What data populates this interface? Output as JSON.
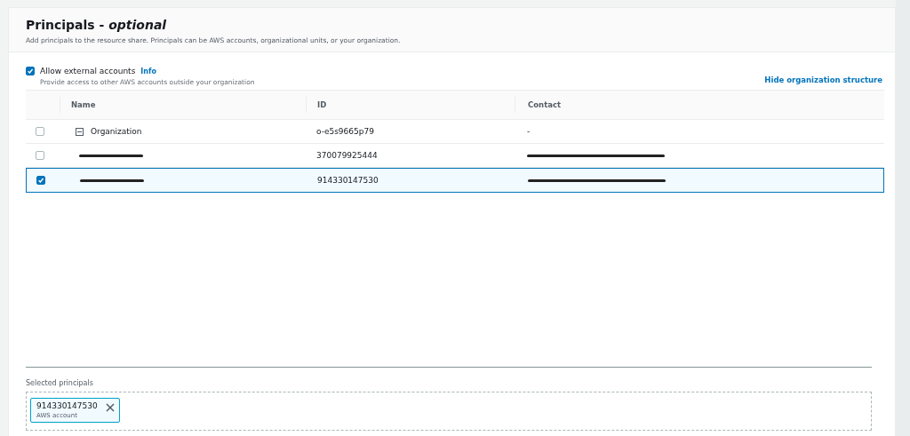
{
  "panel": {
    "title": "Principals - ",
    "title_suffix": "optional",
    "description": "Add principals to the resource share. Principals can be AWS accounts, organizational units, or your organization."
  },
  "allow_external": {
    "label": "Allow external accounts",
    "checked": true,
    "info": "Info",
    "hint": "Provide access to other AWS accounts outside your organization"
  },
  "hide_link": "Hide organization structure",
  "table": {
    "columns": [
      "Name",
      "ID",
      "Contact"
    ],
    "rows": [
      {
        "kind": "organization",
        "selected": false,
        "expanded": true,
        "name": "Organization",
        "id": "o-e5s9665p79",
        "contact": "-"
      },
      {
        "kind": "account",
        "selected": false,
        "name_redacted": true,
        "id": "370079925444",
        "contact_redacted": true
      },
      {
        "kind": "account",
        "selected": true,
        "name_redacted": true,
        "id": "914330147530",
        "contact_redacted": true
      }
    ]
  },
  "selected_principals": {
    "label": "Selected principals",
    "tokens": [
      {
        "value": "914330147530",
        "type": "AWS account"
      }
    ]
  }
}
